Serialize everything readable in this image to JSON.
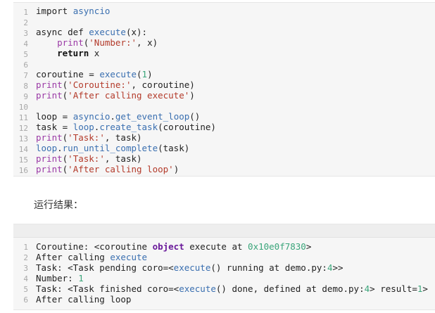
{
  "code": {
    "line_numbers": [
      "1",
      "2",
      "3",
      "4",
      "5",
      "6",
      "7",
      "8",
      "9",
      "10",
      "11",
      "12",
      "13",
      "14",
      "15",
      "16"
    ],
    "lines": [
      [
        {
          "t": "import ",
          "c": "t-kw"
        },
        {
          "t": "asyncio",
          "c": "t-fn"
        }
      ],
      [],
      [
        {
          "t": "async def ",
          "c": "t-kw"
        },
        {
          "t": "execute",
          "c": "t-fn"
        },
        {
          "t": "(x):",
          "c": "t-plain"
        }
      ],
      [
        {
          "t": "    ",
          "c": "t-plain"
        },
        {
          "t": "print",
          "c": "t-builtin"
        },
        {
          "t": "(",
          "c": "t-plain"
        },
        {
          "t": "'Number:'",
          "c": "t-str"
        },
        {
          "t": ", x)",
          "c": "t-plain"
        }
      ],
      [
        {
          "t": "    ",
          "c": "t-plain"
        },
        {
          "t": "return",
          "c": "t-bold"
        },
        {
          "t": " x",
          "c": "t-plain"
        }
      ],
      [],
      [
        {
          "t": "coroutine = ",
          "c": "t-plain"
        },
        {
          "t": "execute",
          "c": "t-fn"
        },
        {
          "t": "(",
          "c": "t-plain"
        },
        {
          "t": "1",
          "c": "t-num"
        },
        {
          "t": ")",
          "c": "t-plain"
        }
      ],
      [
        {
          "t": "print",
          "c": "t-builtin"
        },
        {
          "t": "(",
          "c": "t-plain"
        },
        {
          "t": "'Coroutine:'",
          "c": "t-str"
        },
        {
          "t": ", coroutine)",
          "c": "t-plain"
        }
      ],
      [
        {
          "t": "print",
          "c": "t-builtin"
        },
        {
          "t": "(",
          "c": "t-plain"
        },
        {
          "t": "'After calling execute'",
          "c": "t-str"
        },
        {
          "t": ")",
          "c": "t-plain"
        }
      ],
      [],
      [
        {
          "t": "loop = ",
          "c": "t-plain"
        },
        {
          "t": "asyncio",
          "c": "t-fn"
        },
        {
          "t": ".",
          "c": "t-plain"
        },
        {
          "t": "get_event_loop",
          "c": "t-fn"
        },
        {
          "t": "()",
          "c": "t-plain"
        }
      ],
      [
        {
          "t": "task = ",
          "c": "t-plain"
        },
        {
          "t": "loop",
          "c": "t-fn"
        },
        {
          "t": ".",
          "c": "t-plain"
        },
        {
          "t": "create_task",
          "c": "t-fn"
        },
        {
          "t": "(coroutine)",
          "c": "t-plain"
        }
      ],
      [
        {
          "t": "print",
          "c": "t-builtin"
        },
        {
          "t": "(",
          "c": "t-plain"
        },
        {
          "t": "'Task:'",
          "c": "t-str"
        },
        {
          "t": ", task)",
          "c": "t-plain"
        }
      ],
      [
        {
          "t": "loop",
          "c": "t-fn"
        },
        {
          "t": ".",
          "c": "t-plain"
        },
        {
          "t": "run_until_complete",
          "c": "t-fn"
        },
        {
          "t": "(task)",
          "c": "t-plain"
        }
      ],
      [
        {
          "t": "print",
          "c": "t-builtin"
        },
        {
          "t": "(",
          "c": "t-plain"
        },
        {
          "t": "'Task:'",
          "c": "t-str"
        },
        {
          "t": ", task)",
          "c": "t-plain"
        }
      ],
      [
        {
          "t": "print",
          "c": "t-builtin"
        },
        {
          "t": "(",
          "c": "t-plain"
        },
        {
          "t": "'After calling loop'",
          "c": "t-str"
        },
        {
          "t": ")",
          "c": "t-plain"
        }
      ]
    ]
  },
  "result_label": "运行结果：",
  "output": {
    "line_numbers": [
      "1",
      "2",
      "3",
      "4",
      "5",
      "6"
    ],
    "lines": [
      [
        {
          "t": "Coroutine: <coroutine ",
          "c": "t-plain"
        },
        {
          "t": "object",
          "c": "t-obj"
        },
        {
          "t": " execute at ",
          "c": "t-plain"
        },
        {
          "t": "0x10e0f7830",
          "c": "t-num"
        },
        {
          "t": ">",
          "c": "t-plain"
        }
      ],
      [
        {
          "t": "After calling ",
          "c": "t-plain"
        },
        {
          "t": "execute",
          "c": "t-fn"
        }
      ],
      [
        {
          "t": "Task: <Task pending coro=<",
          "c": "t-plain"
        },
        {
          "t": "execute",
          "c": "t-fn"
        },
        {
          "t": "() running at demo.py:",
          "c": "t-plain"
        },
        {
          "t": "4",
          "c": "t-num"
        },
        {
          "t": ">>",
          "c": "t-plain"
        }
      ],
      [
        {
          "t": "Number: ",
          "c": "t-plain"
        },
        {
          "t": "1",
          "c": "t-num"
        }
      ],
      [
        {
          "t": "Task: <Task finished coro=<",
          "c": "t-plain"
        },
        {
          "t": "execute",
          "c": "t-fn"
        },
        {
          "t": "() done, defined at demo.py:",
          "c": "t-plain"
        },
        {
          "t": "4",
          "c": "t-num"
        },
        {
          "t": "> result=",
          "c": "t-plain"
        },
        {
          "t": "1",
          "c": "t-num"
        },
        {
          "t": ">",
          "c": "t-plain"
        }
      ],
      [
        {
          "t": "After calling loop",
          "c": "t-plain"
        }
      ]
    ]
  }
}
